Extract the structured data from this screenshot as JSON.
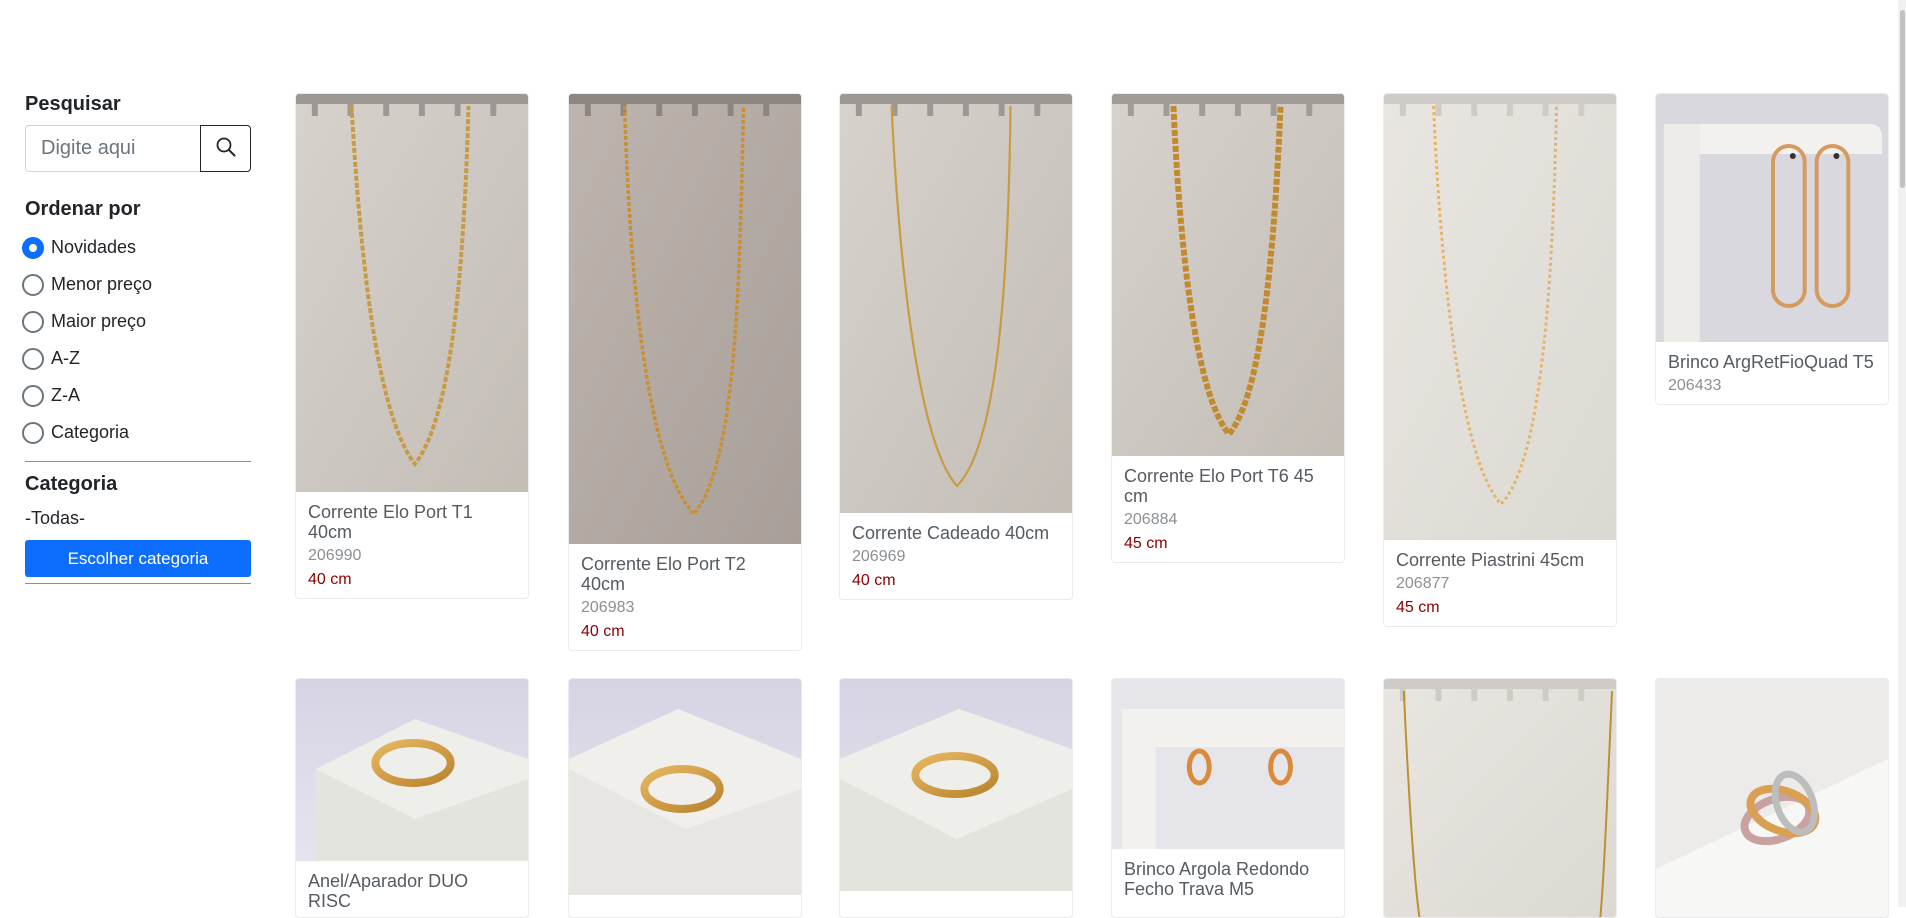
{
  "search": {
    "label": "Pesquisar",
    "placeholder": "Digite aqui"
  },
  "sort": {
    "label": "Ordenar por",
    "selected": "Novidades",
    "options": [
      "Novidades",
      "Menor preço",
      "Maior preço",
      "A-Z",
      "Z-A",
      "Categoria"
    ]
  },
  "category": {
    "label": "Categoria",
    "value": "-Todas-",
    "button": "Escolher categoria"
  },
  "colors": {
    "primary": "#0d6efd",
    "price": "#8b0000"
  },
  "products_row1": [
    {
      "name": "Corrente Elo Port T1 40cm",
      "code": "206990",
      "size": "40 cm",
      "image": "necklace-on-display"
    },
    {
      "name": "Corrente Elo Port T2 40cm",
      "code": "206983",
      "size": "40 cm",
      "image": "necklace-on-display"
    },
    {
      "name": "Corrente Cadeado 40cm",
      "code": "206969",
      "size": "40 cm",
      "image": "necklace-on-display"
    },
    {
      "name": "Corrente Elo Port T6 45 cm",
      "code": "206884",
      "size": "45 cm",
      "image": "necklace-on-display"
    },
    {
      "name": "Corrente Piastrini 45cm",
      "code": "206877",
      "size": "45 cm",
      "image": "necklace-on-display"
    },
    {
      "name": "Brinco ArgRetFioQuad T5",
      "code": "206433",
      "size": "",
      "image": "earrings-on-stand"
    }
  ],
  "products_row2": [
    {
      "name": "Anel/Aparador DUO RISC",
      "image": "ring-on-block"
    },
    {
      "name": "",
      "image": "ring-on-block"
    },
    {
      "name": "",
      "image": "ring-on-block"
    },
    {
      "name": "Brinco Argola Redondo Fecho Trava M5",
      "image": "earrings-on-stand"
    },
    {
      "name": "",
      "image": "necklace-on-display"
    },
    {
      "name": "",
      "image": "rings-stacked"
    }
  ]
}
